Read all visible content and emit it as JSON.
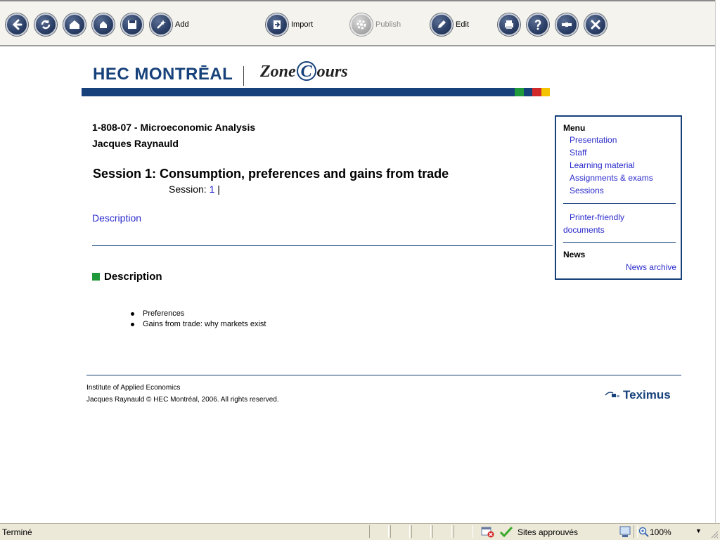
{
  "toolbar": {
    "add_label": "Add",
    "import_label": "Import",
    "publish_label": "Publish",
    "edit_label": "Edit"
  },
  "header": {
    "logo_hec": "HEC MONTRĒAL",
    "logo_zone_a": "Zone",
    "logo_zone_c": "C",
    "logo_zone_b": "ours",
    "accent_colors": [
      "#16417a",
      "#1f9a3a",
      "#d22a2a",
      "#f5c400"
    ]
  },
  "course": {
    "code": "1-808-07 - Microeconomic Analysis",
    "instructor": "Jacques Raynauld",
    "session_title": "Session 1: Consumption, preferences and gains from trade",
    "session_label": "Session: ",
    "session_link": "1",
    "session_sep": " |",
    "description_link": "Description"
  },
  "description": {
    "heading": "Description",
    "items": [
      "Preferences",
      "Gains from trade: why markets exist"
    ]
  },
  "menu": {
    "heading": "Menu",
    "items": [
      "Presentation",
      "Staff",
      "Learning material",
      "Assignments & exams",
      "Sessions"
    ],
    "printer_line1": "Printer-friendly",
    "printer_line2": "documents",
    "news_heading": "News",
    "news_archive": "News archive"
  },
  "footer": {
    "institute": "Institute of Applied Economics",
    "copyright": "Jacques Raynauld © HEC Montréal, 2006. All rights reserved.",
    "teximus": "Teximus"
  },
  "statusbar": {
    "status": "Terminé",
    "zone": "Sites approuvés",
    "zoom": "100%"
  }
}
